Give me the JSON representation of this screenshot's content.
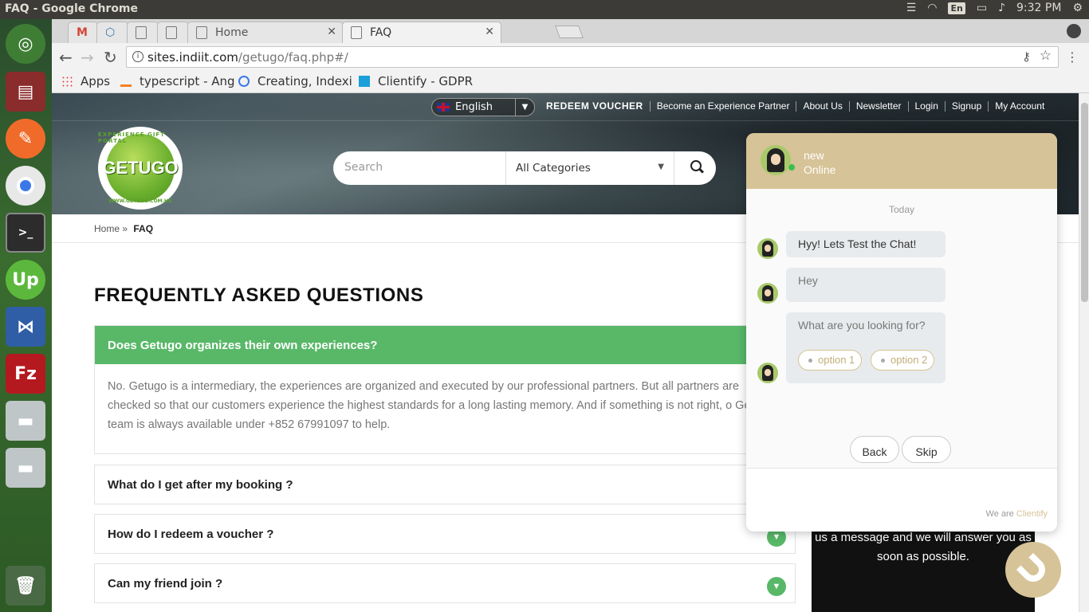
{
  "os": {
    "window_title": "FAQ - Google Chrome",
    "keyboard_layout": "En",
    "clock": "9:32 PM"
  },
  "launcher": {
    "items": [
      "ubuntu-dash",
      "files",
      "postman",
      "chrome",
      "terminal",
      "upwork",
      "vscode",
      "filezilla",
      "drive",
      "drive",
      "trash"
    ]
  },
  "browser": {
    "tabs": [
      {
        "label": "",
        "icon": "gmail-icon"
      },
      {
        "label": "",
        "icon": "hexagon-icon"
      },
      {
        "label": "",
        "icon": "page-icon"
      },
      {
        "label": "",
        "icon": "page-icon"
      },
      {
        "label": "Home",
        "icon": "page-icon"
      },
      {
        "label": "FAQ",
        "icon": "page-icon",
        "active": true
      }
    ],
    "url_host": "sites.indiit.com",
    "url_path": "/getugo/faq.php#/",
    "bookmarks": [
      "Apps",
      "typescript - Ang",
      "Creating, Indexi",
      "Clientify - GDPR"
    ]
  },
  "site": {
    "language": "English",
    "nav": [
      "REDEEM VOUCHER",
      "Become an Experience Partner",
      "About Us",
      "Newsletter",
      "Login",
      "Signup",
      "My Account"
    ],
    "logo_text": "GETUGO",
    "logo_ring_top": "EXPERIENCE GIFT PORTAL",
    "logo_ring_bottom": "WWW.GETUGO.COM.HK",
    "search_placeholder": "Search",
    "category": "All Categories",
    "breadcrumb_home": "Home",
    "breadcrumb_sep": "»",
    "breadcrumb_current": "FAQ",
    "faq_title": "FREQUENTLY ASKED QUESTIONS",
    "faq_open": {
      "question": "Does Getugo organizes their own experiences?",
      "answer": "No. Getugo is a intermediary, the experiences are organized and executed by our professional partners. But all partners are checked so that our customers experience the highest standards for a long lasting memory. And if something is not right, o Getugo team is always available under +852 67991097 to help."
    },
    "faq_items": [
      "What do I get after my booking ?",
      "How do I redeem a voucher ?",
      "Can my friend join ?"
    ],
    "sidebox_text": "us a message and we will answer you as soon as possible."
  },
  "chat": {
    "agent_name": "new",
    "status": "Online",
    "day": "Today",
    "messages": [
      "Hyy! Lets Test the Chat!",
      "Hey",
      "What are you looking for?"
    ],
    "options": [
      "option 1",
      "option 2"
    ],
    "back_label": "Back",
    "skip_label": "Skip",
    "powered_prefix": "We are",
    "powered_brand": "Clientify",
    "accent_color": "#d6c397"
  },
  "colors": {
    "faq_green": "#58b868",
    "chat_header": "#d6c397"
  }
}
